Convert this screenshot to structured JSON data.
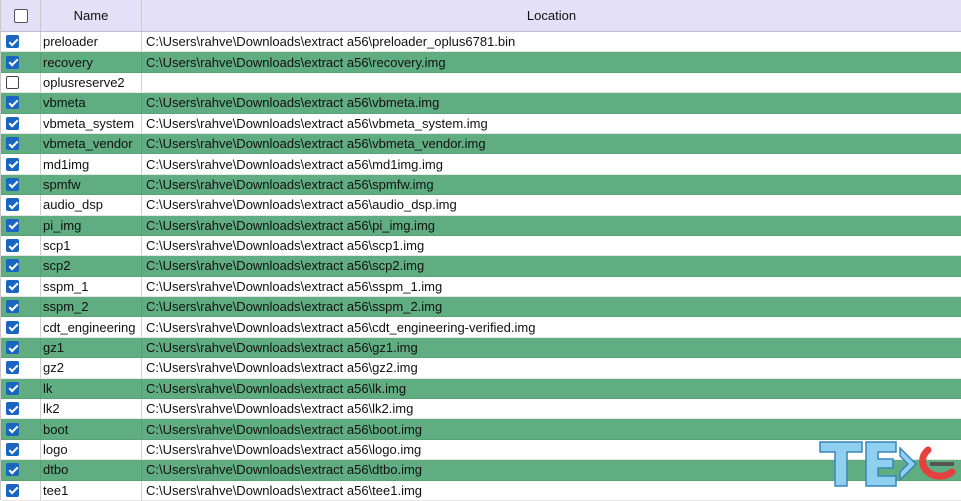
{
  "header": {
    "select_all_checked": false,
    "name_label": "Name",
    "location_label": "Location"
  },
  "rows": [
    {
      "checked": true,
      "name": "preloader",
      "location": "C:\\Users\\rahve\\Downloads\\extract a56\\preloader_oplus6781.bin"
    },
    {
      "checked": true,
      "name": "recovery",
      "location": "C:\\Users\\rahve\\Downloads\\extract a56\\recovery.img"
    },
    {
      "checked": false,
      "name": "oplusreserve2",
      "location": ""
    },
    {
      "checked": true,
      "name": "vbmeta",
      "location": "C:\\Users\\rahve\\Downloads\\extract a56\\vbmeta.img"
    },
    {
      "checked": true,
      "name": "vbmeta_system",
      "location": "C:\\Users\\rahve\\Downloads\\extract a56\\vbmeta_system.img"
    },
    {
      "checked": true,
      "name": "vbmeta_vendor",
      "location": "C:\\Users\\rahve\\Downloads\\extract a56\\vbmeta_vendor.img"
    },
    {
      "checked": true,
      "name": "md1img",
      "location": "C:\\Users\\rahve\\Downloads\\extract a56\\md1img.img"
    },
    {
      "checked": true,
      "name": "spmfw",
      "location": "C:\\Users\\rahve\\Downloads\\extract a56\\spmfw.img"
    },
    {
      "checked": true,
      "name": "audio_dsp",
      "location": "C:\\Users\\rahve\\Downloads\\extract a56\\audio_dsp.img"
    },
    {
      "checked": true,
      "name": "pi_img",
      "location": "C:\\Users\\rahve\\Downloads\\extract a56\\pi_img.img"
    },
    {
      "checked": true,
      "name": "scp1",
      "location": "C:\\Users\\rahve\\Downloads\\extract a56\\scp1.img"
    },
    {
      "checked": true,
      "name": "scp2",
      "location": "C:\\Users\\rahve\\Downloads\\extract a56\\scp2.img"
    },
    {
      "checked": true,
      "name": "sspm_1",
      "location": "C:\\Users\\rahve\\Downloads\\extract a56\\sspm_1.img"
    },
    {
      "checked": true,
      "name": "sspm_2",
      "location": "C:\\Users\\rahve\\Downloads\\extract a56\\sspm_2.img"
    },
    {
      "checked": true,
      "name": "cdt_engineering",
      "location": "C:\\Users\\rahve\\Downloads\\extract a56\\cdt_engineering-verified.img"
    },
    {
      "checked": true,
      "name": "gz1",
      "location": "C:\\Users\\rahve\\Downloads\\extract a56\\gz1.img"
    },
    {
      "checked": true,
      "name": "gz2",
      "location": "C:\\Users\\rahve\\Downloads\\extract a56\\gz2.img"
    },
    {
      "checked": true,
      "name": "lk",
      "location": "C:\\Users\\rahve\\Downloads\\extract a56\\lk.img"
    },
    {
      "checked": true,
      "name": "lk2",
      "location": "C:\\Users\\rahve\\Downloads\\extract a56\\lk2.img"
    },
    {
      "checked": true,
      "name": "boot",
      "location": "C:\\Users\\rahve\\Downloads\\extract a56\\boot.img"
    },
    {
      "checked": true,
      "name": "logo",
      "location": "C:\\Users\\rahve\\Downloads\\extract a56\\logo.img"
    },
    {
      "checked": true,
      "name": "dtbo",
      "location": "C:\\Users\\rahve\\Downloads\\extract a56\\dtbo.img"
    },
    {
      "checked": true,
      "name": "tee1",
      "location": "C:\\Users\\rahve\\Downloads\\extract a56\\tee1.img"
    }
  ],
  "colors": {
    "header_bg": "#e3e0f7",
    "alt_row_bg": "#5fad80",
    "checkbox_checked": "#1a65c0",
    "logo_blue": "#8fd0f0",
    "logo_red": "#e64040"
  },
  "watermark": {
    "icon": "logo-watermark-icon",
    "text": "TEC"
  }
}
